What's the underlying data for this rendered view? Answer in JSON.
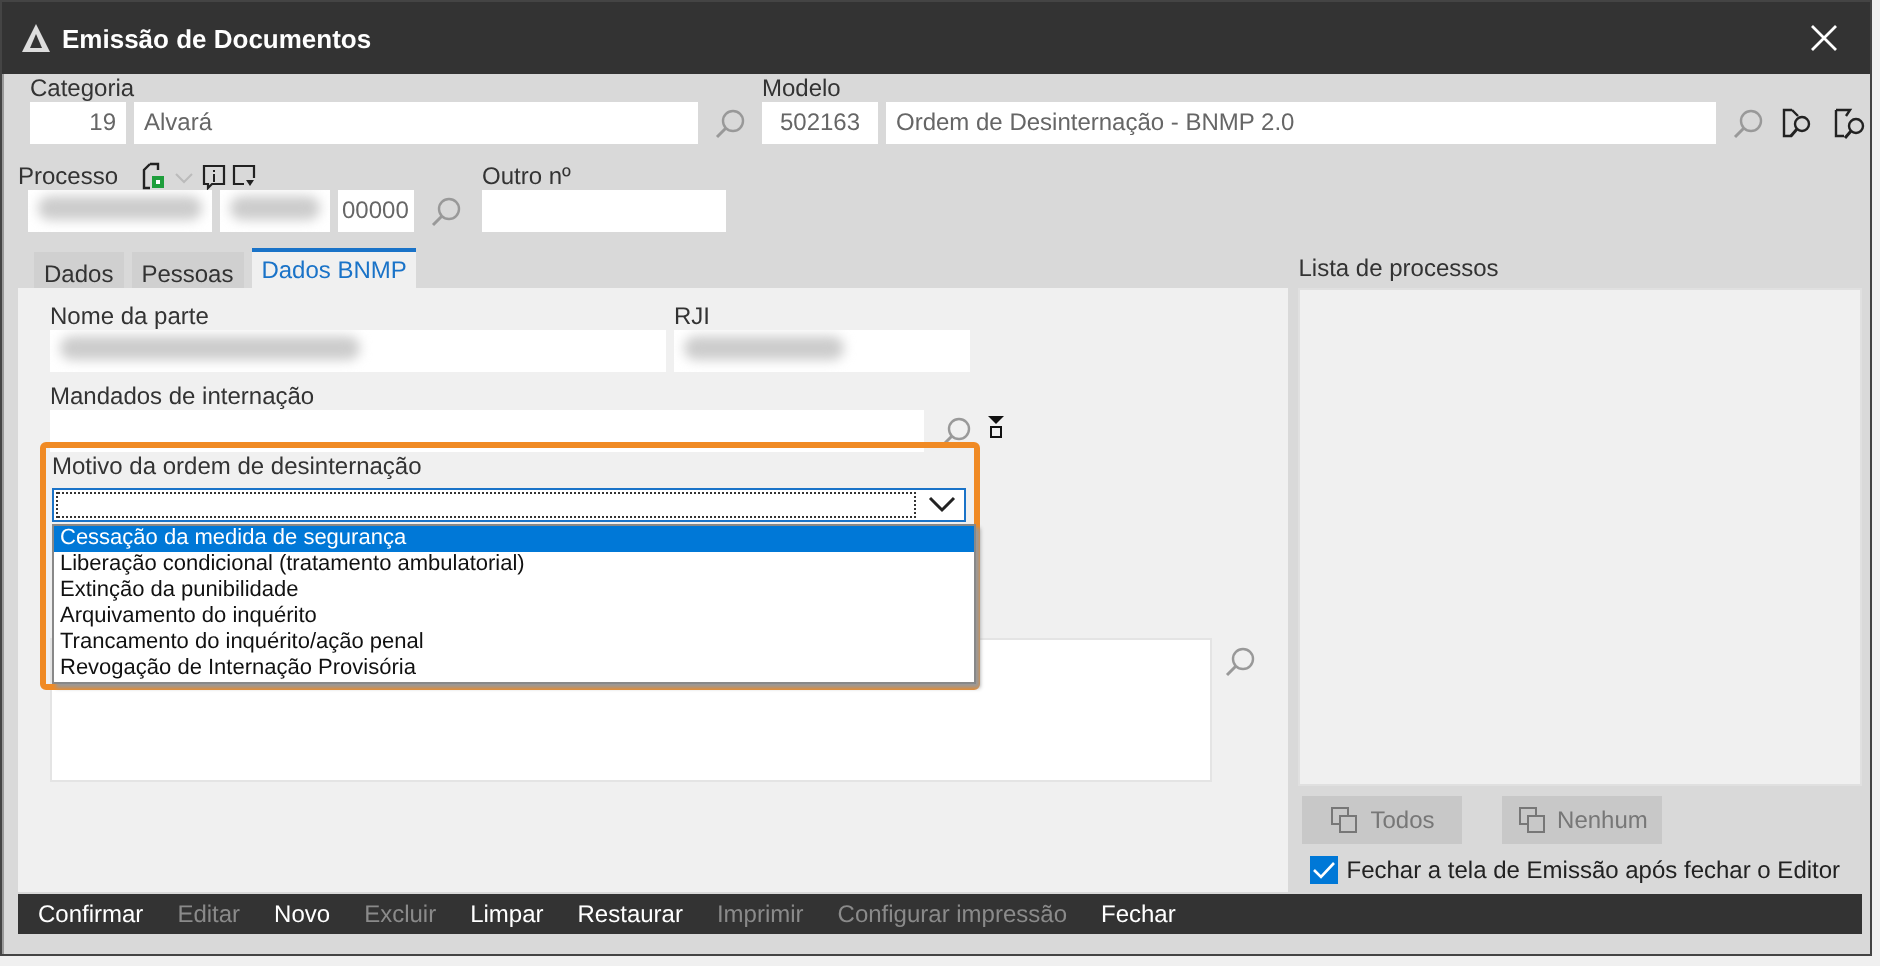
{
  "window": {
    "title": "Emissão de Documentos"
  },
  "categoria": {
    "label": "Categoria",
    "code": "19",
    "name": "Alvará"
  },
  "modelo": {
    "label": "Modelo",
    "code": "502163",
    "name": "Ordem de Desinternação - BNMP 2.0"
  },
  "processo": {
    "label": "Processo",
    "suffix": "00000"
  },
  "outro_numero": {
    "label": "Outro nº"
  },
  "tabs": [
    {
      "label": "Dados",
      "selected": false
    },
    {
      "label": "Pessoas",
      "selected": false
    },
    {
      "label": "Dados BNMP",
      "selected": true
    }
  ],
  "nome_da_parte": {
    "label": "Nome da parte"
  },
  "rji": {
    "label": "RJI"
  },
  "mandados": {
    "label": "Mandados de internação"
  },
  "motivo": {
    "label": "Motivo da ordem de desinternação",
    "expanded": true,
    "options": [
      {
        "label": "Cessação da medida de segurança",
        "selected": true
      },
      {
        "label": "Liberação condicional (tratamento ambulatorial)",
        "selected": false
      },
      {
        "label": "Extinção da punibilidade",
        "selected": false
      },
      {
        "label": "Arquivamento do inquérito",
        "selected": false
      },
      {
        "label": "Trancamento do inquérito/ação penal",
        "selected": false
      },
      {
        "label": "Revogação de Internação Provisória",
        "selected": false
      }
    ]
  },
  "lista_de_processos": {
    "label": "Lista de processos"
  },
  "list_buttons": [
    {
      "label": "Todos",
      "disabled": true
    },
    {
      "label": "Nenhum",
      "disabled": true
    }
  ],
  "close_option": {
    "label": "Fechar a tela de Emissão após fechar o Editor",
    "checked": true
  },
  "toolbar": [
    {
      "label": "Confirmar",
      "disabled": false
    },
    {
      "label": "Editar",
      "disabled": true
    },
    {
      "label": "Novo",
      "disabled": false
    },
    {
      "label": "Excluir",
      "disabled": true
    },
    {
      "label": "Limpar",
      "disabled": false
    },
    {
      "label": "Restaurar",
      "disabled": false
    },
    {
      "label": "Imprimir",
      "disabled": true
    },
    {
      "label": "Configurar impressão",
      "disabled": true
    },
    {
      "label": "Fechar",
      "disabled": false
    }
  ]
}
